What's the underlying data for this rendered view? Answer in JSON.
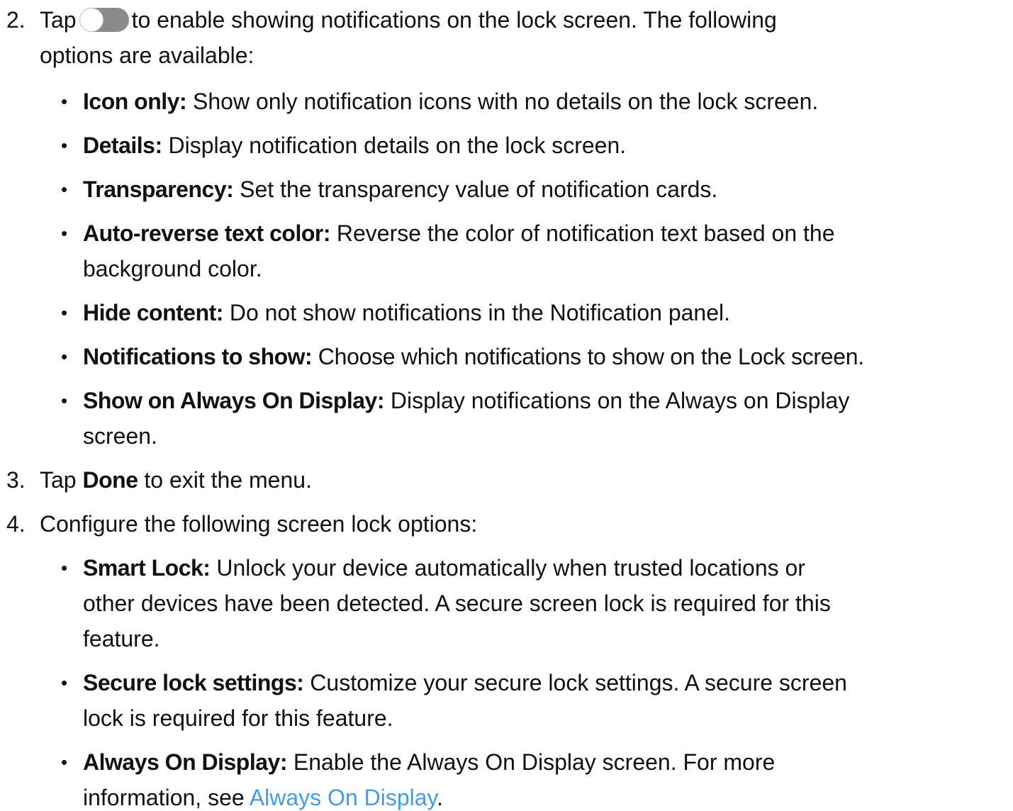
{
  "steps": [
    {
      "number": "2.",
      "text_before_toggle": "Tap",
      "toggle_state": "off",
      "text_after_toggle": "to enable showing notifications on the lock screen. The following",
      "continuation": "options are available:",
      "options": [
        {
          "term": "Icon only",
          "sep": ":",
          "desc": " Show only notification icons with no details on the lock screen."
        },
        {
          "term": "Details:",
          "sep": "",
          "desc": " Display notification details on the lock screen."
        },
        {
          "term": "Transparency",
          "sep": ":",
          "desc": " Set the transparency value of notification cards."
        },
        {
          "term": "Auto-reverse text color",
          "sep": ":",
          "desc": " Reverse the color of notification text based on the",
          "desc_line2": "background color."
        },
        {
          "term": "Hide content:",
          "sep": "",
          "desc": " Do not show notifications in the Notification panel."
        },
        {
          "term": "Notifications to show",
          "sep": ":",
          "desc": " Choose which notifications to show on the Lock screen."
        },
        {
          "term": "Show on Always On Display",
          "sep": ":",
          "desc": " Display notifications on the Always on Display",
          "desc_line2": "screen."
        }
      ]
    },
    {
      "number": "3.",
      "prefix": "Tap ",
      "term": "Done",
      "suffix": " to exit the menu."
    },
    {
      "number": "4.",
      "text": "Configure the following screen lock options:",
      "options": [
        {
          "term": "Smart Lock",
          "sep": ":",
          "desc": " Unlock your device automatically when trusted locations or",
          "desc_line2": "other devices have been detected. A secure screen lock is required for this",
          "desc_line3": "feature."
        },
        {
          "term": "Secure lock settings",
          "sep": ":",
          "desc": " Customize your secure lock settings. A secure screen",
          "desc_line2": "lock is required for this feature."
        },
        {
          "term": "Always On Display",
          "sep": ":",
          "desc": " Enable the Always On Display screen. For more",
          "desc_line2_prefix": "information, see ",
          "link_text": "Always On Display",
          "desc_line2_suffix": "."
        }
      ]
    }
  ],
  "colors": {
    "text": "#111111",
    "link": "#4a9ae0",
    "toggle_track": "#8a8a8a"
  }
}
